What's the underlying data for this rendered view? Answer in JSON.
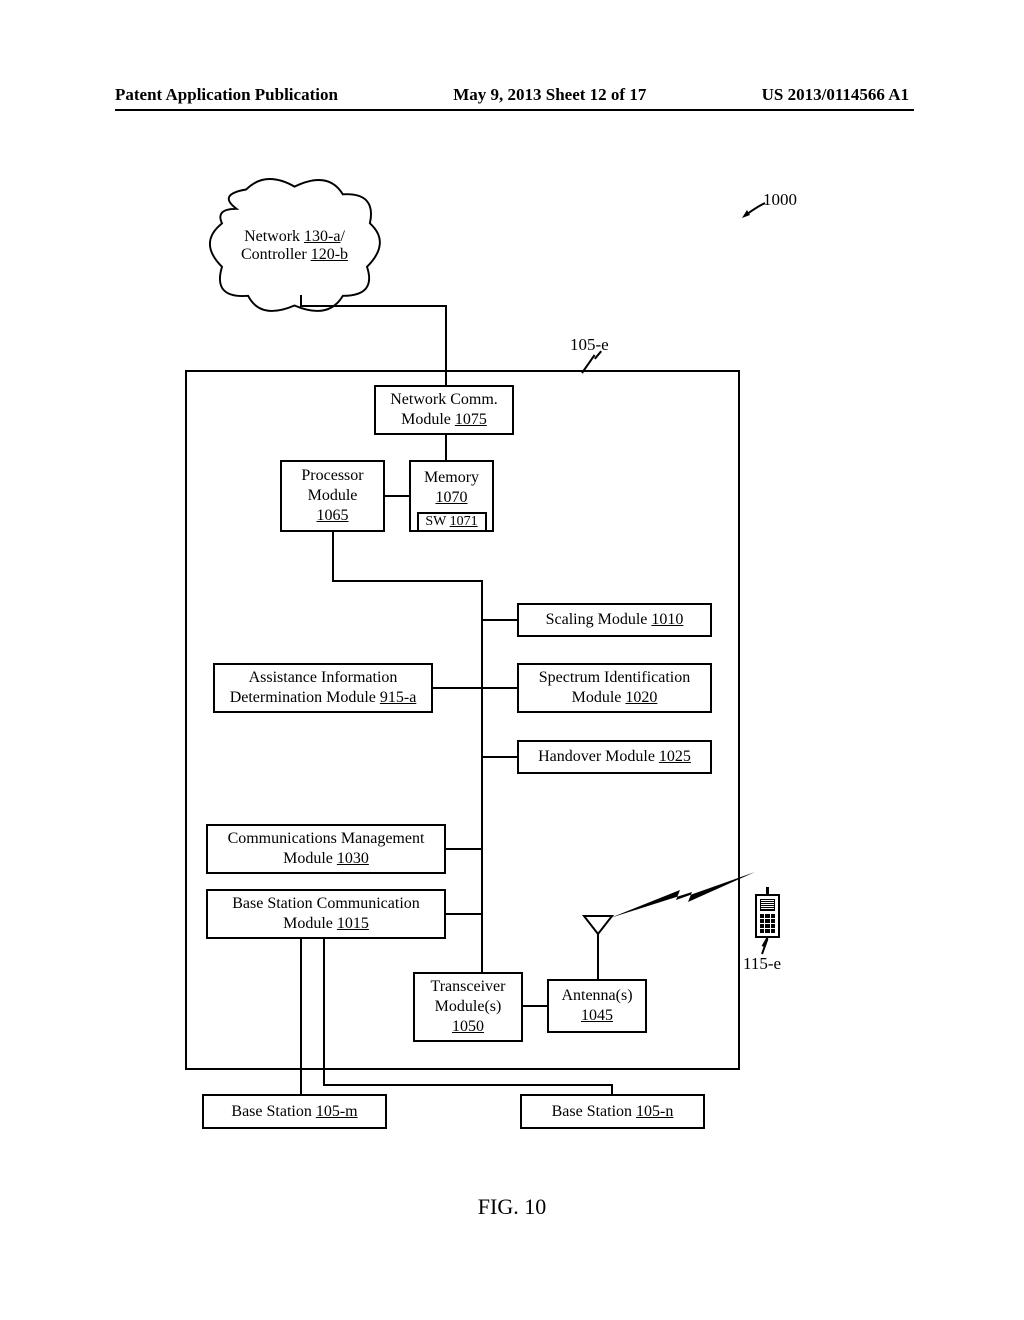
{
  "header": {
    "left": "Patent Application Publication",
    "center": "May 9, 2013  Sheet 12 of 17",
    "right": "US 2013/0114566 A1"
  },
  "figure_caption": "FIG. 10",
  "labels": {
    "ref_1000": "1000",
    "ref_105e": "105-e",
    "ref_115e": "115-e"
  },
  "cloud": {
    "line1_pre": "Network ",
    "line1_ref": "130-a",
    "line1_post": "/",
    "line2_pre": "Controller ",
    "line2_ref": "120-b"
  },
  "blocks": {
    "ncm": {
      "t": "Network Comm.",
      "m": "Module ",
      "r": "1075"
    },
    "proc": {
      "t": "Processor",
      "m": "Module",
      "r": "1065"
    },
    "mem": {
      "t": "Memory",
      "r": "1070"
    },
    "sw": {
      "t": "SW ",
      "r": "1071"
    },
    "scale": {
      "t": "Scaling Module ",
      "r": "1010"
    },
    "ai": {
      "t": "Assistance Information",
      "m": "Determination Module ",
      "r": "915-a"
    },
    "si": {
      "t": "Spectrum Identification",
      "m": "Module ",
      "r": "1020"
    },
    "ho": {
      "t": "Handover Module ",
      "r": "1025"
    },
    "cmm": {
      "t": "Communications Management",
      "m": "Module ",
      "r": "1030"
    },
    "bsc": {
      "t": "Base Station Communication",
      "m": "Module ",
      "r": "1015"
    },
    "tx": {
      "t": "Transceiver",
      "m": "Module(s)",
      "r": "1050"
    },
    "ant": {
      "t": "Antenna(s)",
      "r": "1045"
    },
    "bsm": {
      "t": "Base Station ",
      "r": "105-m"
    },
    "bsn": {
      "t": "Base Station ",
      "r": "105-n"
    }
  }
}
